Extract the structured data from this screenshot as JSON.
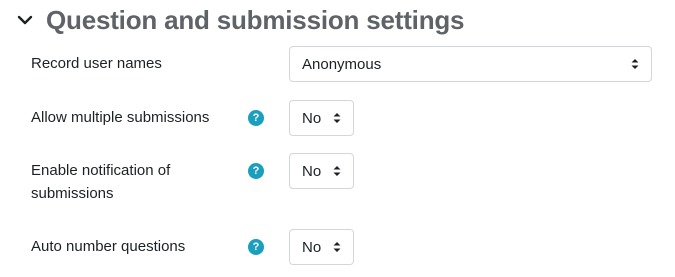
{
  "section": {
    "title": "Question and submission settings"
  },
  "fields": {
    "record_user_names": {
      "label": "Record user names",
      "value": "Anonymous"
    },
    "allow_multiple": {
      "label": "Allow multiple submissions",
      "value": "No"
    },
    "enable_notification": {
      "label_line1": "Enable notification of",
      "label_line2": "submissions",
      "value": "No"
    },
    "auto_number": {
      "label": "Auto number questions",
      "value": "No"
    }
  },
  "icons": {
    "help": "?",
    "help_color": "#1a9fbf"
  }
}
